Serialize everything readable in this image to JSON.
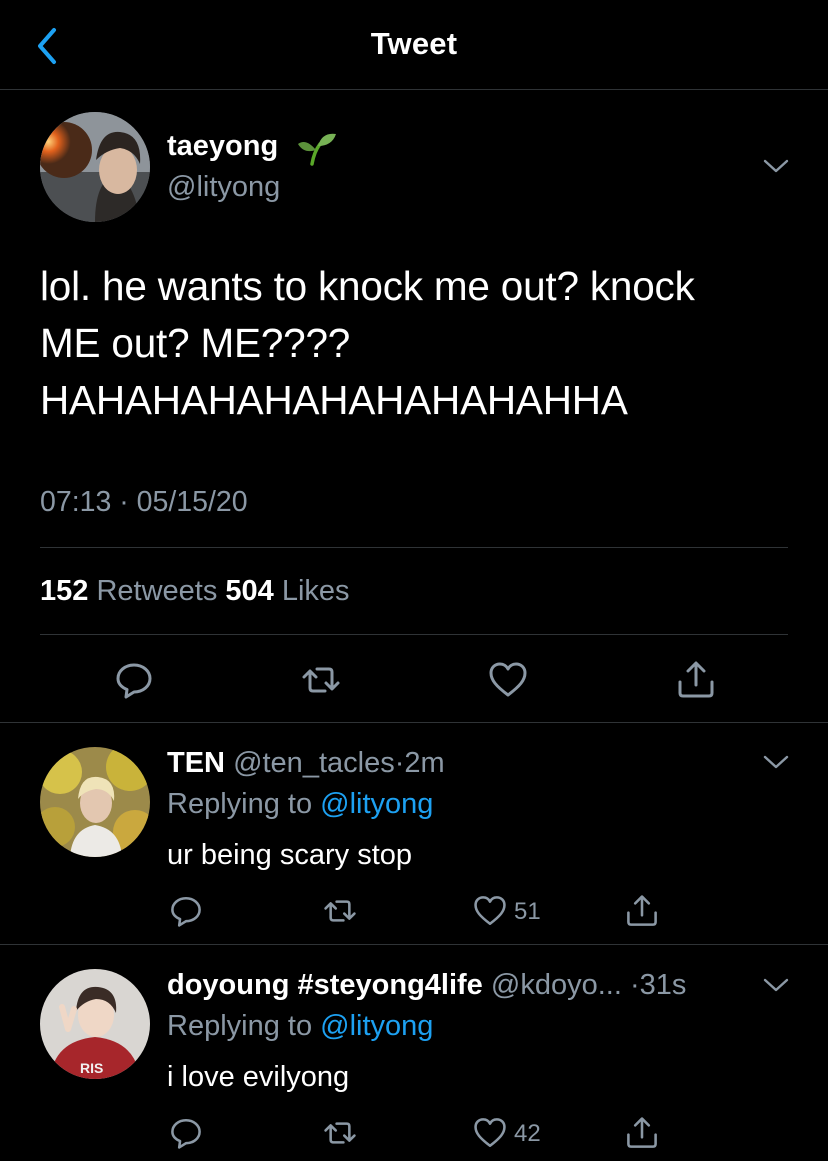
{
  "header": {
    "title": "Tweet"
  },
  "tweet": {
    "display_name": "taeyong",
    "name_emoji": "seedling",
    "handle": "@lityong",
    "text_lines": [
      "lol. he wants to knock me out? knock",
      "ME out? ME????",
      "HAHAHAHAHAHAHAHAHAHHA"
    ],
    "timestamp": "07:13 · 05/15/20",
    "retweets_count": "152",
    "retweets_label": "Retweets",
    "likes_count": "504",
    "likes_label": "Likes"
  },
  "replies": [
    {
      "display_name": "TEN",
      "handle": "@ten_tacles",
      "separator": "·",
      "time": "2m",
      "replying_prefix": "Replying to",
      "replying_to": "@lityong",
      "text": "ur being scary stop",
      "like_count": "51"
    },
    {
      "display_name": "doyoung #steyong4life",
      "handle": "@kdoyo...",
      "separator": "·",
      "time": "31s",
      "replying_prefix": "Replying to",
      "replying_to": "@lityong",
      "text": "i love evilyong",
      "like_count": "42"
    }
  ],
  "colors": {
    "background": "#000000",
    "muted": "#8b98a5",
    "link": "#1da1f2",
    "accent": "#1da1f2",
    "divider": "#2f3336"
  },
  "icons": {
    "back": "chevron-left-icon",
    "more": "chevron-down-icon",
    "reply": "reply-icon",
    "retweet": "retweet-icon",
    "like": "heart-icon",
    "share": "share-icon"
  }
}
